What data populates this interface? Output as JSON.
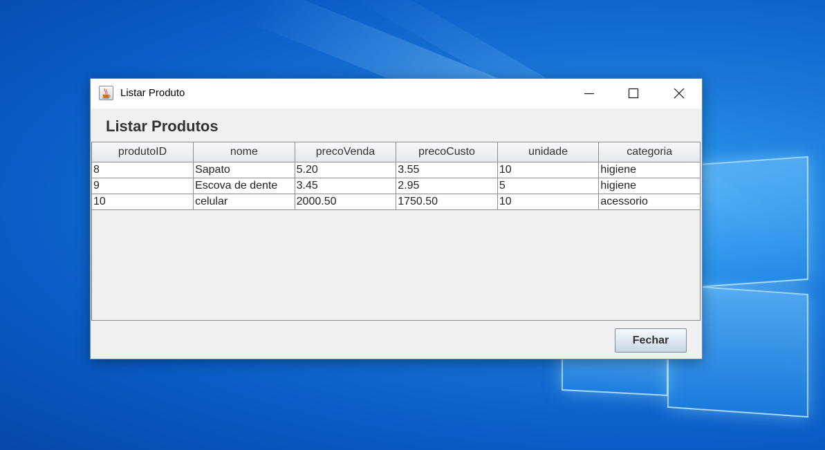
{
  "window": {
    "title": "Listar Produto",
    "icon": "java-cup-icon",
    "controls": [
      "minimize-icon",
      "maximize-icon",
      "close-icon"
    ]
  },
  "header": {
    "label": "Listar Produtos"
  },
  "table": {
    "columns": [
      "produtoID",
      "nome",
      "precoVenda",
      "precoCusto",
      "unidade",
      "categoria"
    ],
    "rows": [
      [
        "8",
        "Sapato",
        "5.20",
        "3.55",
        "10",
        "higiene"
      ],
      [
        "9",
        "Escova de dente",
        "3.45",
        "2.95",
        "5",
        "higiene"
      ],
      [
        "10",
        "celular",
        "2000.50",
        "1750.50",
        "10",
        "acessorio"
      ]
    ]
  },
  "footer": {
    "close_label": "Fechar"
  },
  "colors": {
    "desktop_blue": "#0a5cc6",
    "window_border": "#5b86c6",
    "window_bg": "#f0f0f0"
  }
}
